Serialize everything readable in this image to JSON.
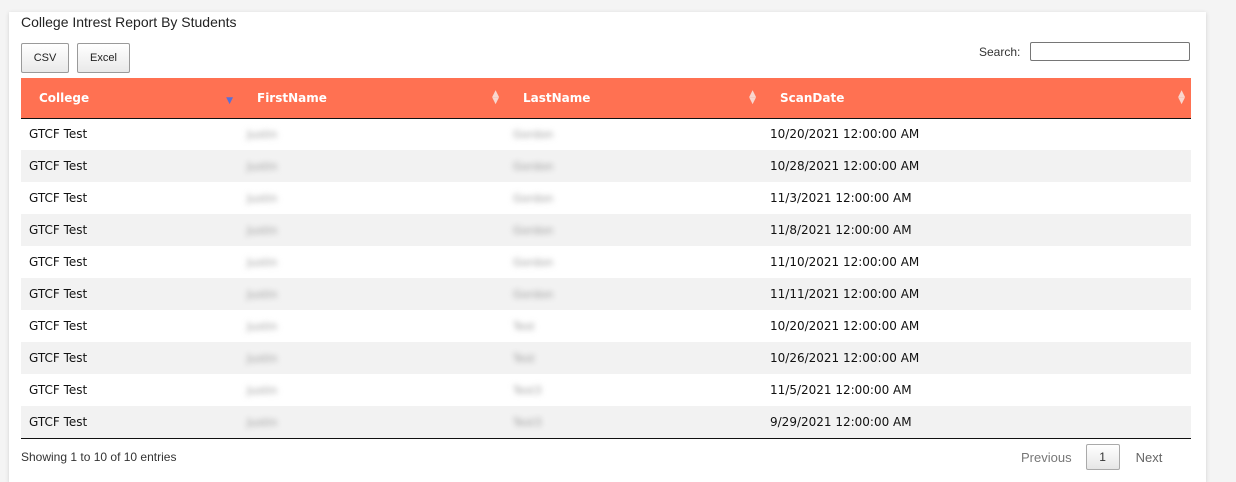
{
  "report": {
    "title": "College Intrest Report By Students"
  },
  "toolbar": {
    "csv_label": "CSV",
    "excel_label": "Excel",
    "search_label": "Search:",
    "search_value": ""
  },
  "table": {
    "columns": [
      {
        "label": "College",
        "sort": "ascending"
      },
      {
        "label": "FirstName",
        "sort": "none"
      },
      {
        "label": "LastName",
        "sort": "none"
      },
      {
        "label": "ScanDate",
        "sort": "none"
      }
    ],
    "rows": [
      {
        "college": "GTCF Test",
        "first": "Justin",
        "last": "Gordon",
        "date": "10/20/2021 12:00:00 AM"
      },
      {
        "college": "GTCF Test",
        "first": "Justin",
        "last": "Gordon",
        "date": "10/28/2021 12:00:00 AM"
      },
      {
        "college": "GTCF Test",
        "first": "Justin",
        "last": "Gordon",
        "date": "11/3/2021 12:00:00 AM"
      },
      {
        "college": "GTCF Test",
        "first": "Justin",
        "last": "Gordon",
        "date": "11/8/2021 12:00:00 AM"
      },
      {
        "college": "GTCF Test",
        "first": "Justin",
        "last": "Gordon",
        "date": "11/10/2021 12:00:00 AM"
      },
      {
        "college": "GTCF Test",
        "first": "Justin",
        "last": "Gordon",
        "date": "11/11/2021 12:00:00 AM"
      },
      {
        "college": "GTCF Test",
        "first": "Justin",
        "last": "Test",
        "date": "10/20/2021 12:00:00 AM"
      },
      {
        "college": "GTCF Test",
        "first": "Justin",
        "last": "Test",
        "date": "10/26/2021 12:00:00 AM"
      },
      {
        "college": "GTCF Test",
        "first": "Justin",
        "last": "Test3",
        "date": "11/5/2021 12:00:00 AM"
      },
      {
        "college": "GTCF Test",
        "first": "Justin",
        "last": "Test3",
        "date": "9/29/2021 12:00:00 AM"
      }
    ]
  },
  "footer": {
    "info": "Showing 1 to 10 of 10 entries",
    "previous_label": "Previous",
    "current_page": "1",
    "next_label": "Next"
  },
  "colors": {
    "header_bg": "#ff7152",
    "header_text": "#ffffff",
    "stripe": "#f2f2f2",
    "sort_active": "#5a6fd6"
  },
  "icons": {
    "sort": "sort-both-icon",
    "sort_active": "sort-ascending-icon"
  }
}
